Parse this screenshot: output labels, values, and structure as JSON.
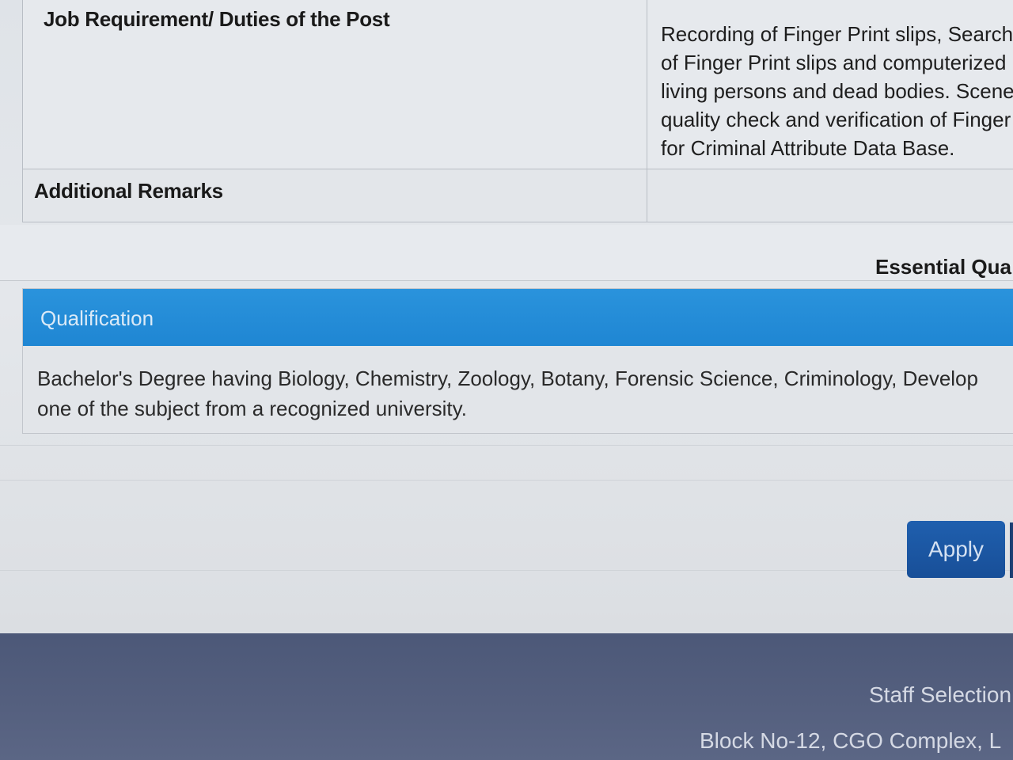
{
  "job_details": {
    "duties_label": "Job Requirement/ Duties of the Post",
    "duties_lines": [
      "Recording of Finger Print slips, Search",
      "of Finger Print slips and computerized",
      "living persons and dead bodies. Scene",
      "quality check and verification of Finger",
      "for Criminal Attribute Data Base."
    ],
    "remarks_label": "Additional Remarks",
    "remarks_value": ""
  },
  "essential_heading": "Essential Qua",
  "qualification": {
    "title": "Qualification",
    "text_lines": [
      "Bachelor's Degree having Biology, Chemistry, Zoology, Botany, Forensic Science, Criminology, Develop",
      "one of the subject from a recognized university."
    ]
  },
  "actions": {
    "apply_label": "Apply"
  },
  "footer": {
    "org": "Staff Selection",
    "address": "Block No-12, CGO Complex, L"
  },
  "colors": {
    "qualification_header": "#1f86d3",
    "apply_button": "#184f98",
    "footer_bg": "#55607f"
  }
}
